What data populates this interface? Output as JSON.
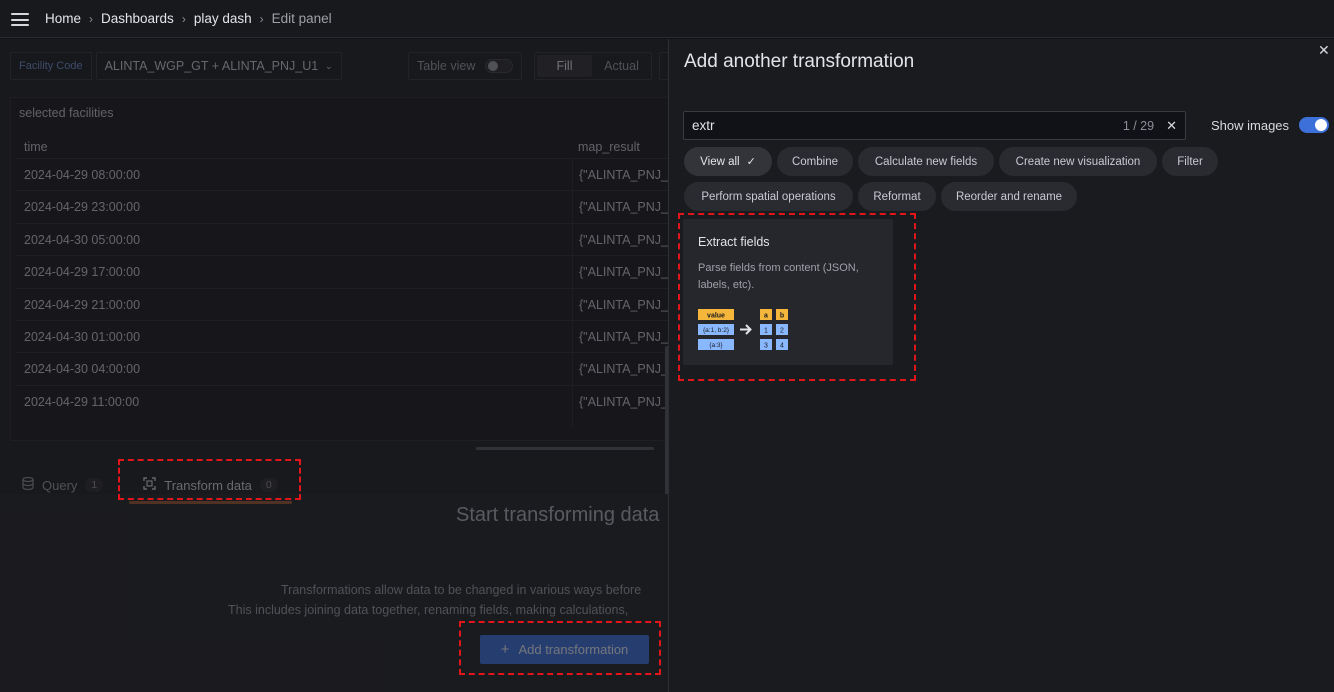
{
  "topbar": {
    "breadcrumbs": [
      "Home",
      "Dashboards",
      "play dash",
      "Edit panel"
    ]
  },
  "variables": {
    "label": "Facility Code",
    "value": "ALINTA_WGP_GT + ALINTA_PNJ_U1"
  },
  "toolbar": {
    "table_view_label": "Table view",
    "fill_label": "Fill",
    "actual_label": "Actual"
  },
  "panel": {
    "title": "selected facilities",
    "columns": [
      "time",
      "map_result"
    ],
    "rows": [
      {
        "time": "2024-04-29 08:00:00",
        "map_result": "{\"ALINTA_PNJ_"
      },
      {
        "time": "2024-04-29 23:00:00",
        "map_result": "{\"ALINTA_PNJ_"
      },
      {
        "time": "2024-04-30 05:00:00",
        "map_result": "{\"ALINTA_PNJ_"
      },
      {
        "time": "2024-04-29 17:00:00",
        "map_result": "{\"ALINTA_PNJ_"
      },
      {
        "time": "2024-04-29 21:00:00",
        "map_result": "{\"ALINTA_PNJ_"
      },
      {
        "time": "2024-04-30 01:00:00",
        "map_result": "{\"ALINTA_PNJ_"
      },
      {
        "time": "2024-04-30 04:00:00",
        "map_result": "{\"ALINTA_PNJ_"
      },
      {
        "time": "2024-04-29 11:00:00",
        "map_result": "{\"ALINTA_PNJ_"
      }
    ]
  },
  "tabs": [
    {
      "label": "Query",
      "count": "1",
      "icon": "database-icon"
    },
    {
      "label": "Transform data",
      "count": "0",
      "icon": "transform-icon"
    }
  ],
  "empty_state": {
    "title": "Start transforming data",
    "line1": "Transformations allow data to be changed in various ways before",
    "line2": "This includes joining data together, renaming fields, making calculations,",
    "button_label": "Add transformation"
  },
  "drawer": {
    "title": "Add another transformation",
    "search_value": "extr",
    "search_count": "1 / 29",
    "show_images_label": "Show images",
    "filters": [
      "View all",
      "Combine",
      "Calculate new fields",
      "Create new visualization",
      "Filter",
      "Perform spatial operations",
      "Reformat",
      "Reorder and rename"
    ],
    "card": {
      "title": "Extract fields",
      "description": "Parse fields from content (JSON, labels, etc).",
      "illus_value": "value",
      "illus_row1": "{a:1, b:2}",
      "illus_row2": "{a:3}",
      "illus_h_a": "a",
      "illus_h_b": "b",
      "illus_c1": "1",
      "illus_c2": "2",
      "illus_c3": "3",
      "illus_c4": "4"
    }
  },
  "colors": {
    "accent": "#3d71d9",
    "highlight": "#e4141b",
    "tab_underline": "#ff7c3a",
    "illus_yellow": "#f5b73b",
    "illus_blue": "#8ab8ff"
  }
}
